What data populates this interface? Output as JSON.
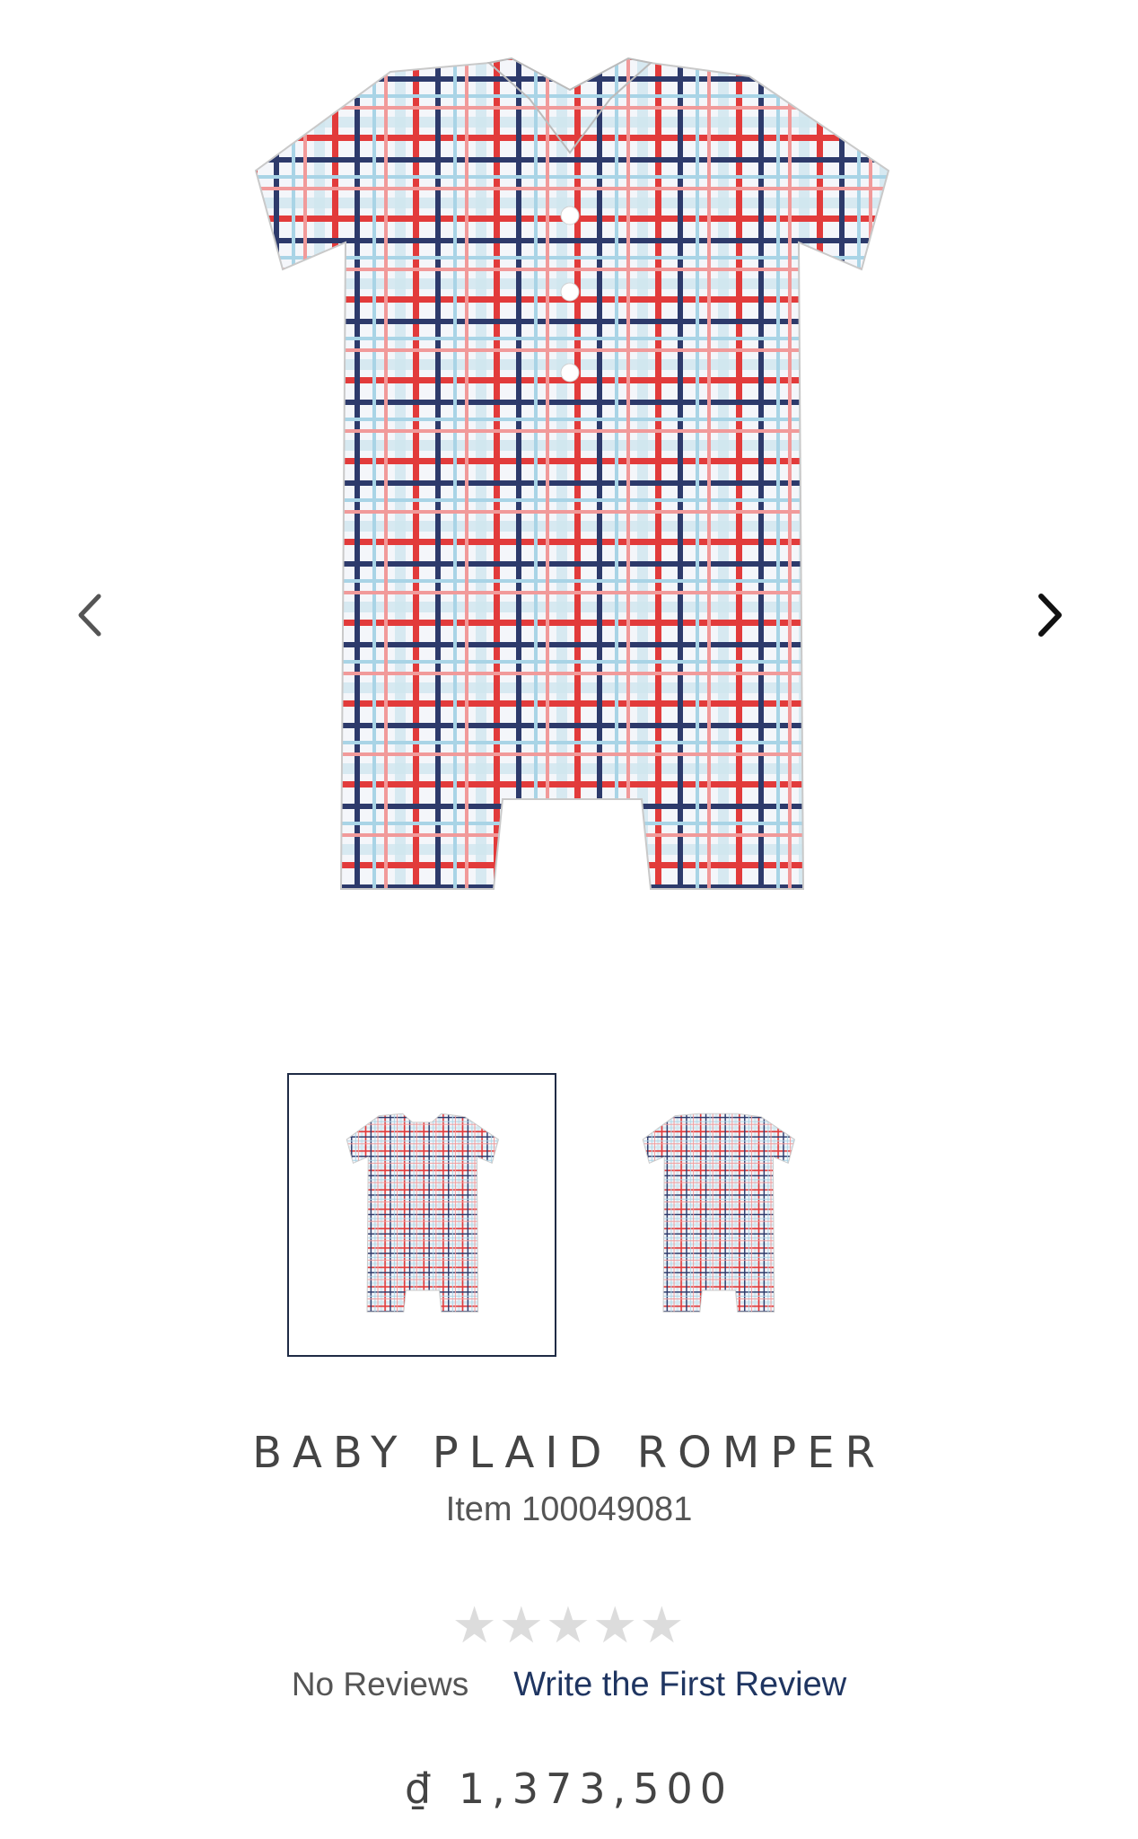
{
  "gallery": {
    "prev_icon": "chevron-left-icon",
    "next_icon": "chevron-right-icon",
    "colors": {
      "red": "#e23b3b",
      "navy": "#2d3a6b",
      "light_blue": "#a9d4e6",
      "fabric": "#f4f6fa"
    }
  },
  "product": {
    "title": "BABY PLAID ROMPER",
    "item_number": "Item 100049081",
    "rating_stars": "★★★★★",
    "rating_value": 0,
    "no_reviews": "No Reviews",
    "write_review": "Write the First Review",
    "price": "₫ 1,373,500"
  }
}
